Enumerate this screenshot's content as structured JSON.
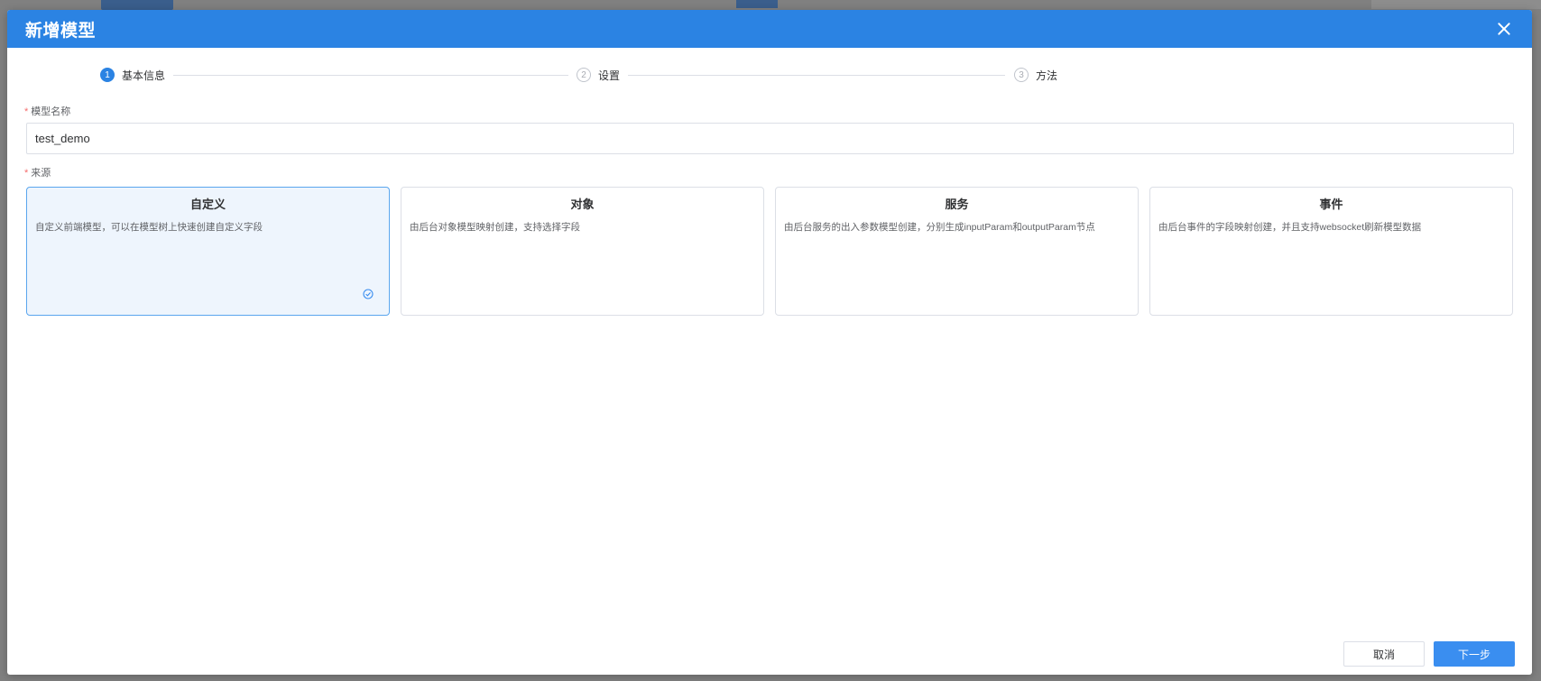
{
  "dialog": {
    "title": "新增模型"
  },
  "steps": [
    {
      "num": "1",
      "label": "基本信息",
      "active": true
    },
    {
      "num": "2",
      "label": "设置",
      "active": false
    },
    {
      "num": "3",
      "label": "方法",
      "active": false
    }
  ],
  "form": {
    "name_label": "模型名称",
    "name_value": "test_demo",
    "source_label": "来源",
    "required_mark": "*"
  },
  "sources": [
    {
      "title": "自定义",
      "desc": "自定义前端模型，可以在模型树上快速创建自定义字段",
      "selected": true
    },
    {
      "title": "对象",
      "desc": "由后台对象模型映射创建，支持选择字段",
      "selected": false
    },
    {
      "title": "服务",
      "desc": "由后台服务的出入参数模型创建，分别生成inputParam和outputParam节点",
      "selected": false
    },
    {
      "title": "事件",
      "desc": "由后台事件的字段映射创建，并且支持websocket刷新模型数据",
      "selected": false
    }
  ],
  "footer": {
    "cancel_label": "取消",
    "next_label": "下一步"
  },
  "colors": {
    "primary": "#2b83e3",
    "selected_bg": "#eef5fd",
    "required": "#f56c6c"
  },
  "icons": {
    "close": "close-icon",
    "selected": "check-circle-icon"
  }
}
